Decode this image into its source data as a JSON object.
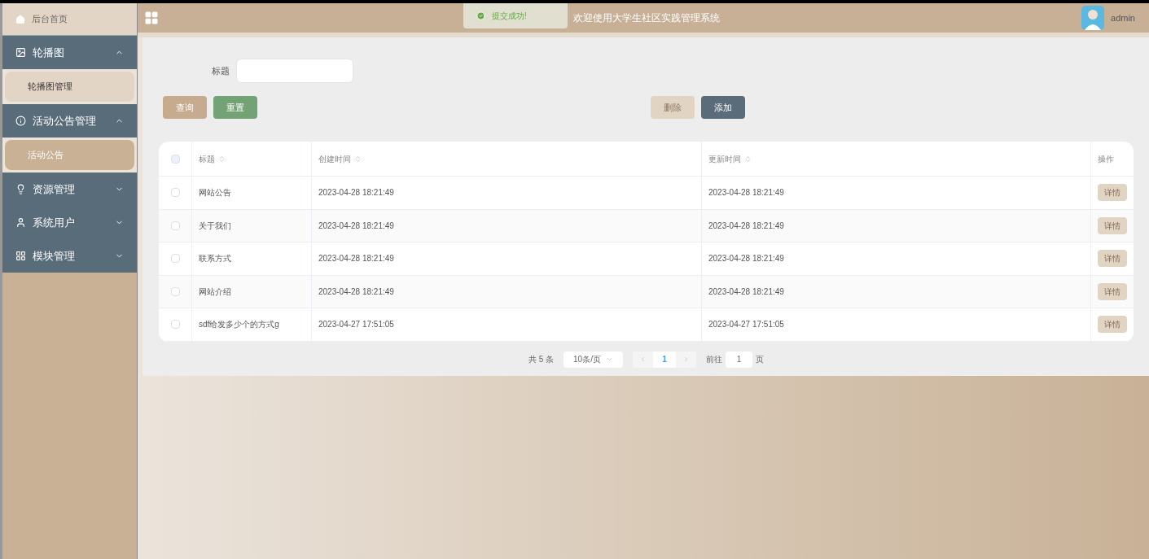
{
  "sidebar": {
    "home": {
      "label": "后台首页"
    },
    "groups": [
      {
        "label": "轮播图",
        "expanded": true,
        "children": [
          {
            "label": "轮播图管理",
            "selected": false
          }
        ]
      },
      {
        "label": "活动公告管理",
        "expanded": true,
        "children": [
          {
            "label": "活动公告",
            "selected": true
          }
        ]
      },
      {
        "label": "资源管理",
        "expanded": false
      },
      {
        "label": "系统用户",
        "expanded": false
      },
      {
        "label": "模块管理",
        "expanded": false
      }
    ]
  },
  "header": {
    "title": "欢迎使用大学生社区实践管理系统",
    "user": "admin",
    "toast": "提交成功!"
  },
  "search": {
    "label": "标题",
    "buttons": [
      "查询",
      "重置"
    ]
  },
  "actions": [
    {
      "label": "删除",
      "disabled": true
    },
    {
      "label": "添加",
      "disabled": false
    }
  ],
  "table": {
    "select_all_checked": false,
    "columns": [
      "标题",
      "创建时间",
      "更新时间",
      "操作"
    ],
    "rows": [
      {
        "title": "网站公告",
        "created": "2023-04-28 18:21:49",
        "updated": "2023-04-28 18:21:49",
        "action": "详情",
        "checked": false
      },
      {
        "title": "关于我们",
        "created": "2023-04-28 18:21:49",
        "updated": "2023-04-28 18:21:49",
        "action": "详情",
        "checked": false
      },
      {
        "title": "联系方式",
        "created": "2023-04-28 18:21:49",
        "updated": "2023-04-28 18:21:49",
        "action": "详情",
        "checked": false
      },
      {
        "title": "网站介绍",
        "created": "2023-04-28 18:21:49",
        "updated": "2023-04-28 18:21:49",
        "action": "详情",
        "checked": false
      },
      {
        "title": "sdf给发多少个的方式g",
        "created": "2023-04-27 17:51:05",
        "updated": "2023-04-27 17:51:05",
        "action": "详情",
        "checked": false
      }
    ]
  },
  "pagination": {
    "total": "共 5 条",
    "page_size": "10条/页",
    "pages": [
      {
        "label": "1",
        "selected": true
      }
    ],
    "goto_label": "前往",
    "goto_value": "1",
    "goto_suffix": "页"
  }
}
